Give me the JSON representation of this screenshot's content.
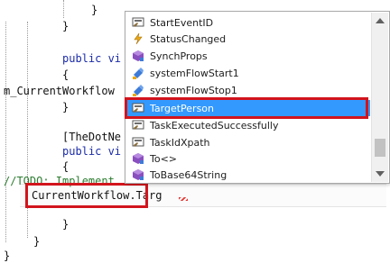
{
  "editor": {
    "lines": {
      "l1": "}",
      "l2": "}",
      "l3_kw": "public vi",
      "l4": "{",
      "l5": "m_CurrentWorkflow",
      "l6": "}",
      "l7": "[TheDotNe",
      "l8_kw": "public vi",
      "l9": "{",
      "l10_comment": "//TODO: Implement",
      "l11": "CurrentWorkflow.Targ",
      "l12": "}",
      "l13": "}",
      "l14": "}"
    }
  },
  "intellisense": {
    "items": [
      {
        "label": "StartEventID",
        "icon": "property-icon"
      },
      {
        "label": "StatusChanged",
        "icon": "event-icon"
      },
      {
        "label": "SynchProps",
        "icon": "method-icon"
      },
      {
        "label": "systemFlowStart1",
        "icon": "field-icon"
      },
      {
        "label": "systemFlowStop1",
        "icon": "field-icon"
      },
      {
        "label": "TargetPerson",
        "icon": "property-icon",
        "selected": true
      },
      {
        "label": "TaskExecutedSuccessfully",
        "icon": "property-icon"
      },
      {
        "label": "TaskIdXpath",
        "icon": "property-icon"
      },
      {
        "label": "To<>",
        "icon": "method-icon"
      },
      {
        "label": "ToBase64String",
        "icon": "method-icon"
      }
    ]
  },
  "colors": {
    "highlight_border": "#d2141c",
    "selection": "#3399ff",
    "keyword": "#1b2ca8",
    "comment": "#2e7d32"
  }
}
